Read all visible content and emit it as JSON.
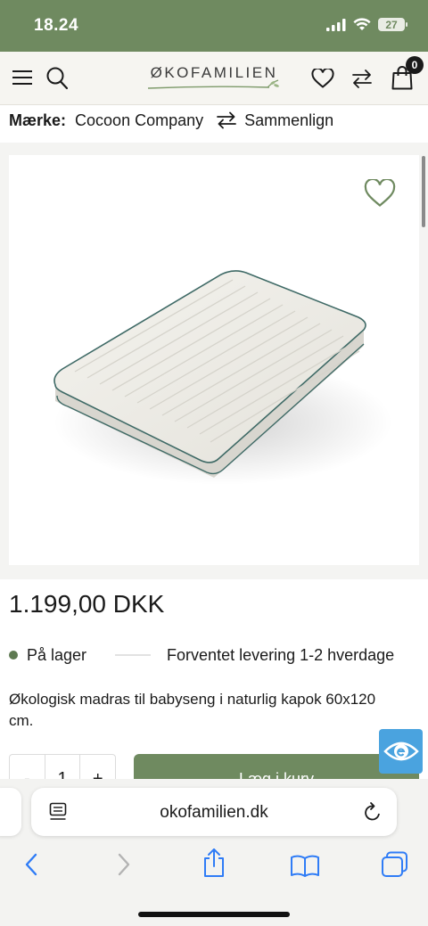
{
  "status_bar": {
    "time": "18.24",
    "battery": "27"
  },
  "header": {
    "logo_text": "ØKOFAMILIEN",
    "cart_count": "0",
    "icons": [
      "menu-icon",
      "search-icon",
      "heart-icon",
      "compare-icon",
      "bag-icon"
    ]
  },
  "product": {
    "brand_label": "Mærke:",
    "brand_name": "Cocoon Company",
    "compare_label": "Sammenlign",
    "price": "1.199,00 DKK",
    "stock_status": "På lager",
    "delivery": "Forventet levering 1-2 hverdage",
    "description": "Økologisk madras til babyseng i naturlig kapok 60x120 cm.",
    "quantity": "1",
    "quantity_minus": "-",
    "quantity_plus": "+",
    "add_to_cart": "Læg i kurv"
  },
  "browser": {
    "url": "okofamilien.dk",
    "nav": [
      "back-icon",
      "forward-icon",
      "share-icon",
      "bookmarks-icon",
      "tabs-icon"
    ]
  },
  "colors": {
    "brand_green": "#6f8a60",
    "accessibility_blue": "#4aa3df"
  }
}
